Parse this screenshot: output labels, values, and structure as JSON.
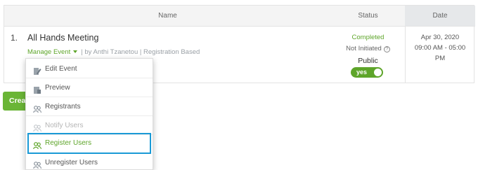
{
  "table": {
    "headers": {
      "name": "Name",
      "status": "Status",
      "date": "Date"
    },
    "row": {
      "index": "1.",
      "title": "All Hands Meeting",
      "manage_label": "Manage Event",
      "meta_rest": "| by Anthi Tzanetou | Registration Based",
      "status_completed": "Completed",
      "status_initiated": "Not Initiated",
      "help_symbol": "?",
      "visibility": "Public",
      "toggle_label": "yes",
      "date_line1": "Apr 30, 2020",
      "date_line2": "09:00 AM - 05:00",
      "date_line3": "PM"
    }
  },
  "create_button_label": "Crea",
  "menu": {
    "items": [
      {
        "label": "Edit Event",
        "icon": "pencil-icon",
        "state": "normal"
      },
      {
        "label": "Preview",
        "icon": "preview-icon",
        "state": "normal"
      },
      {
        "label": "Registrants",
        "icon": "users-icon",
        "state": "normal"
      },
      {
        "label": "Notify Users",
        "icon": "users-icon",
        "state": "disabled"
      },
      {
        "label": "Register Users",
        "icon": "users-icon",
        "state": "highlighted"
      },
      {
        "label": "Unregister Users",
        "icon": "users-icon",
        "state": "normal"
      }
    ]
  },
  "colors": {
    "accent_green": "#5ea52a",
    "highlight_border": "#1a9ad6",
    "header_bg": "#f4f4f4",
    "muted_text": "#9aa0a6"
  }
}
